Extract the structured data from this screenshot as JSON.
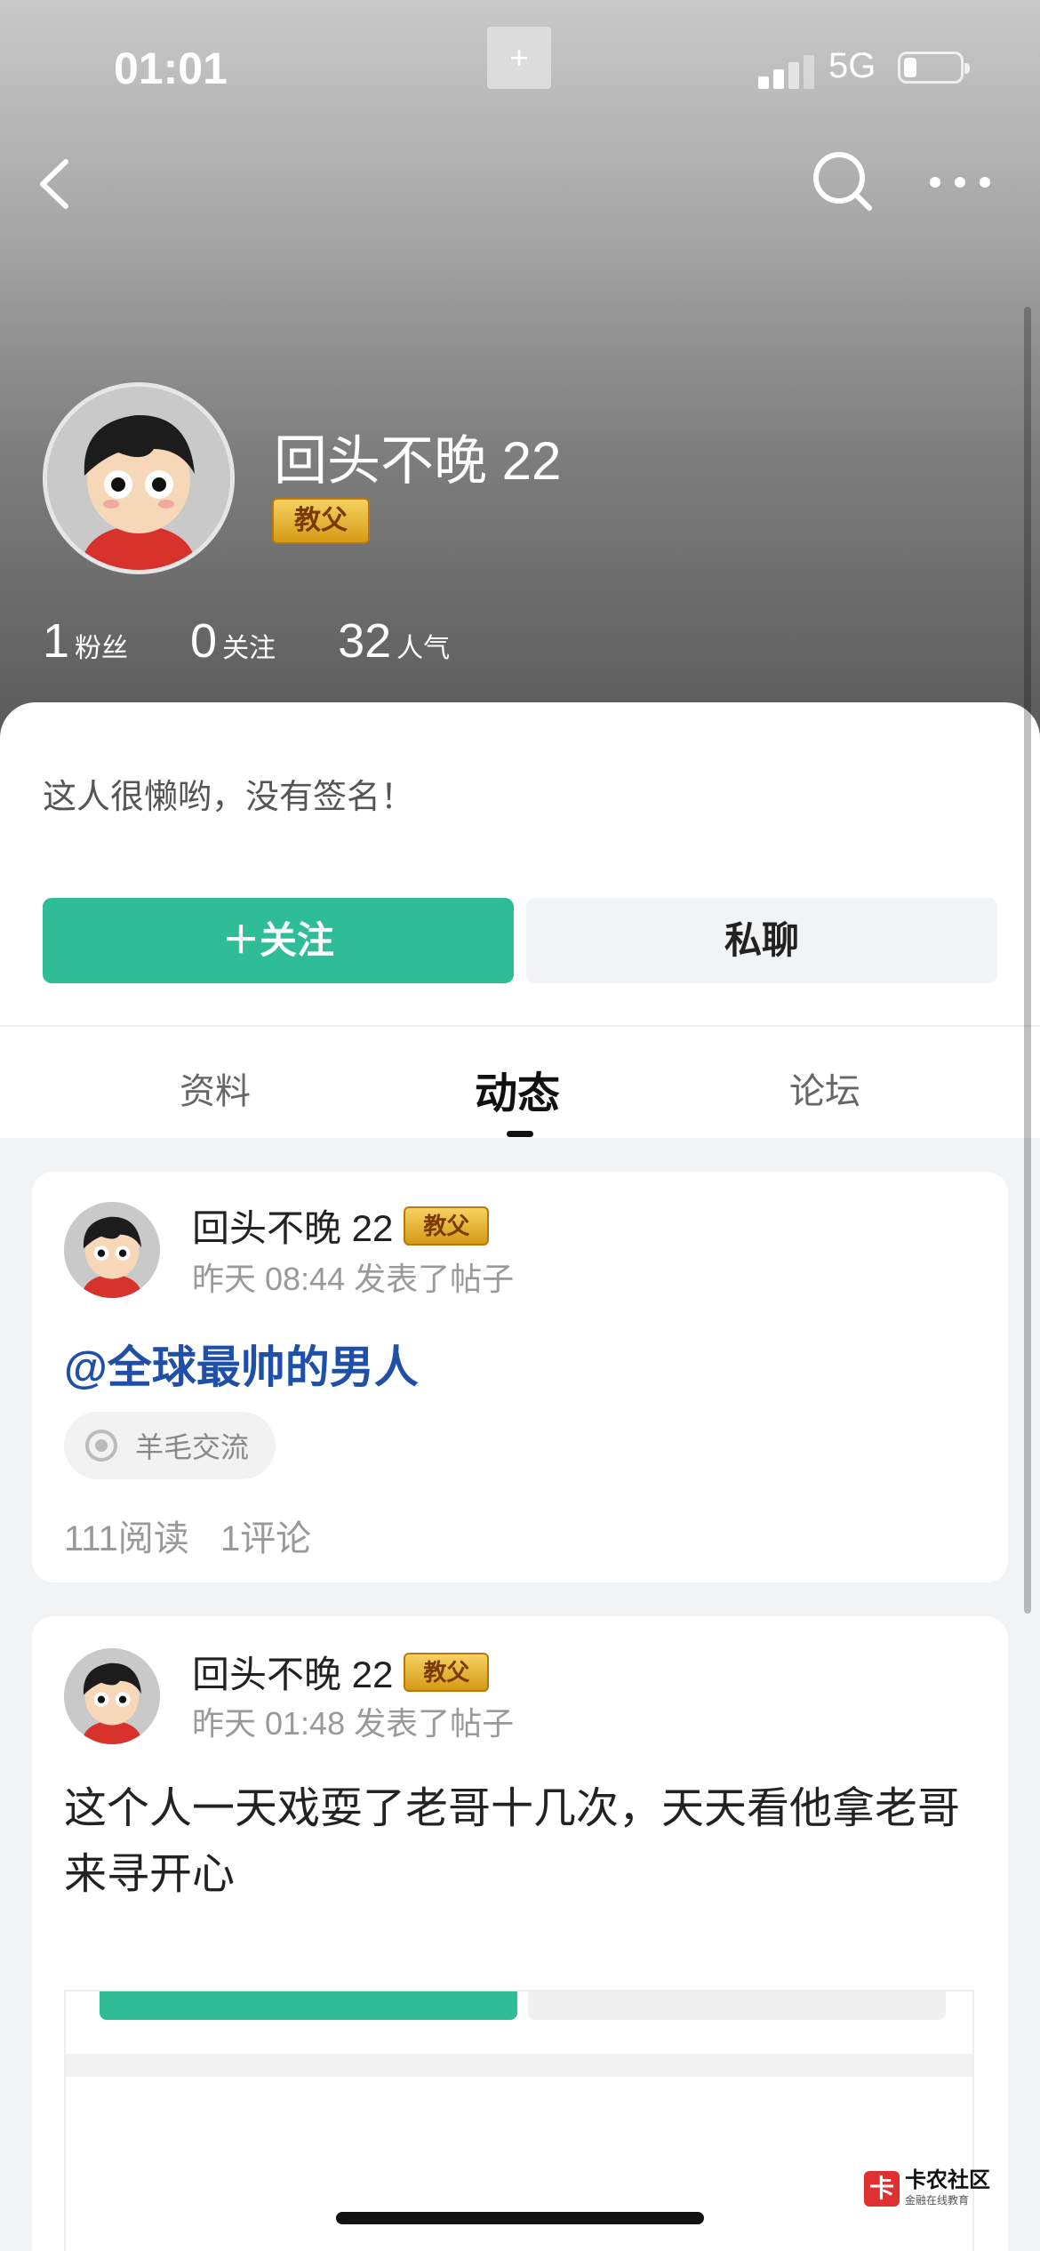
{
  "status_bar": {
    "time": "01:01",
    "notch_button": "+",
    "network": "5G"
  },
  "profile": {
    "name": "回头不晚 22",
    "badge": "教父",
    "stats": [
      {
        "value": "1",
        "label": "粉丝"
      },
      {
        "value": "0",
        "label": "关注"
      },
      {
        "value": "32",
        "label": "人气"
      }
    ],
    "bio": "这人很懒哟，没有签名！",
    "follow_label": "＋关注",
    "chat_label": "私聊"
  },
  "tabs": [
    {
      "label": "资料",
      "active": false
    },
    {
      "label": "动态",
      "active": true
    },
    {
      "label": "论坛",
      "active": false
    }
  ],
  "posts": [
    {
      "author": "回头不晚 22",
      "badge": "教父",
      "meta": "昨天 08:44 发表了帖子",
      "title": "@全球最帅的男人",
      "topic": "羊毛交流",
      "reads": "111阅读",
      "comments": "1评论"
    },
    {
      "author": "回头不晚 22",
      "badge": "教父",
      "meta": "昨天 01:48 发表了帖子",
      "text": "这个人一天戏耍了老哥十几次，天天看他拿老哥来寻开心"
    }
  ],
  "watermark": {
    "logo": "卡",
    "title": "卡农社区",
    "subtitle": "金融在线教育"
  },
  "colors": {
    "accent_green": "#2ebd96",
    "mention_blue": "#1f4fa6",
    "badge_gold": "#e3b232"
  }
}
